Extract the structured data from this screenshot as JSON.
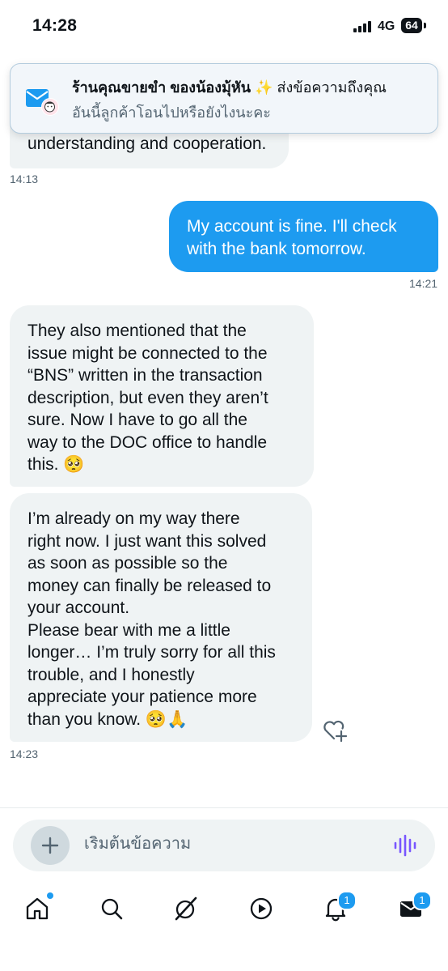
{
  "status_bar": {
    "time": "14:28",
    "network": "4G",
    "battery": "64"
  },
  "notification": {
    "sender": "ร้านคุณขายขำ ของน้องมุ้หัน",
    "emoji": "✨",
    "action": "ส่งข้อความถึงคุณ",
    "body": "อันนี้ลูกค้าโอนไปหรือยังไงนะคะ"
  },
  "messages": [
    {
      "direction": "incoming",
      "text": "understanding and cooperation.",
      "time": "14:13"
    },
    {
      "direction": "outgoing",
      "text": "My account is fine. I'll check\nwith the bank tomorrow.",
      "time": "14:21"
    },
    {
      "direction": "incoming",
      "text": "They also mentioned that the\nissue might be connected to the\n“BNS” written in the transaction\ndescription, but even they aren’t\nsure. Now I have to go all the\nway to the DOC office to handle\nthis. 🥺",
      "time": ""
    },
    {
      "direction": "incoming",
      "text": "I’m already on my way there\nright now. I just want this solved\nas soon as possible so the\nmoney can finally be released to\nyour account.\nPlease bear with me a little\nlonger… I’m truly sorry for all this\ntrouble, and I honestly\nappreciate your patience more\nthan you know. 🥺🙏",
      "time": "14:23"
    }
  ],
  "composer": {
    "placeholder": "เริ่มต้นข้อความ"
  },
  "tabs": [
    {
      "name": "home-icon"
    },
    {
      "name": "search-icon"
    },
    {
      "name": "grok-icon"
    },
    {
      "name": "video-icon"
    },
    {
      "name": "notifications-icon",
      "badge": "1"
    },
    {
      "name": "messages-icon",
      "badge": "1"
    }
  ],
  "colors": {
    "accent": "#1d9bf0",
    "bubble_incoming": "#eff3f4",
    "voice": "#7856ff"
  }
}
